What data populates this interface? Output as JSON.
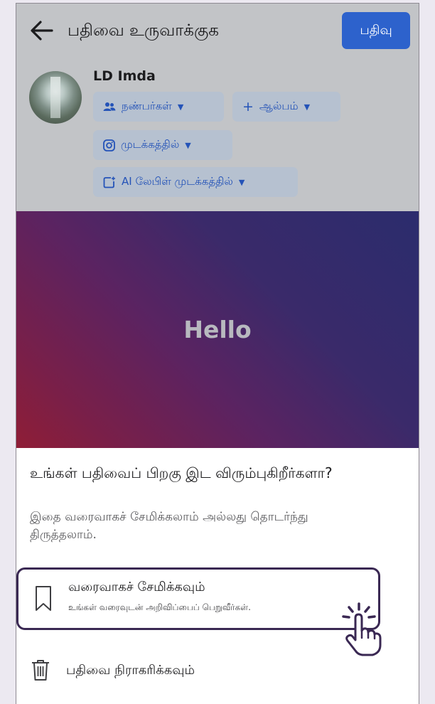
{
  "header": {
    "back_icon": "arrow-left-icon",
    "title": "பதிவை உருவாக்குக",
    "post_button": "பதிவு"
  },
  "user": {
    "name": "LD Imda"
  },
  "chips": {
    "audience": {
      "label": "நண்பர்கள்",
      "icon": "people-icon"
    },
    "album": {
      "label": "ஆல்பம்",
      "prefix": "+"
    },
    "instagram": {
      "label": "முடக்கத்தில்",
      "icon": "instagram-icon"
    },
    "ai_label": {
      "label": "AI லேபிள் முடக்கத்தில்",
      "icon": "ai-sparkle-icon"
    }
  },
  "card": {
    "text": "Hello"
  },
  "sheet": {
    "title": "உங்கள் பதிவைப் பிறகு இட விரும்புகிறீர்களா?",
    "subtitle": "இதை வரைவாகச் சேமிக்கலாம் அல்லது தொடர்ந்து திருத்தலாம்.",
    "save_draft": {
      "label": "வரைவாகச் சேமிக்கவும்",
      "description": "உங்கள் வரைவுடன் அறிவிப்பைப் பெறுவீர்கள்.",
      "icon": "bookmark-icon"
    },
    "discard": {
      "label": "பதிவை நிராகரிக்கவும்",
      "icon": "trash-icon"
    }
  },
  "colors": {
    "accent": "#2d62cc",
    "highlight_border": "#3a2853",
    "overlay": "#c2c4c7"
  }
}
